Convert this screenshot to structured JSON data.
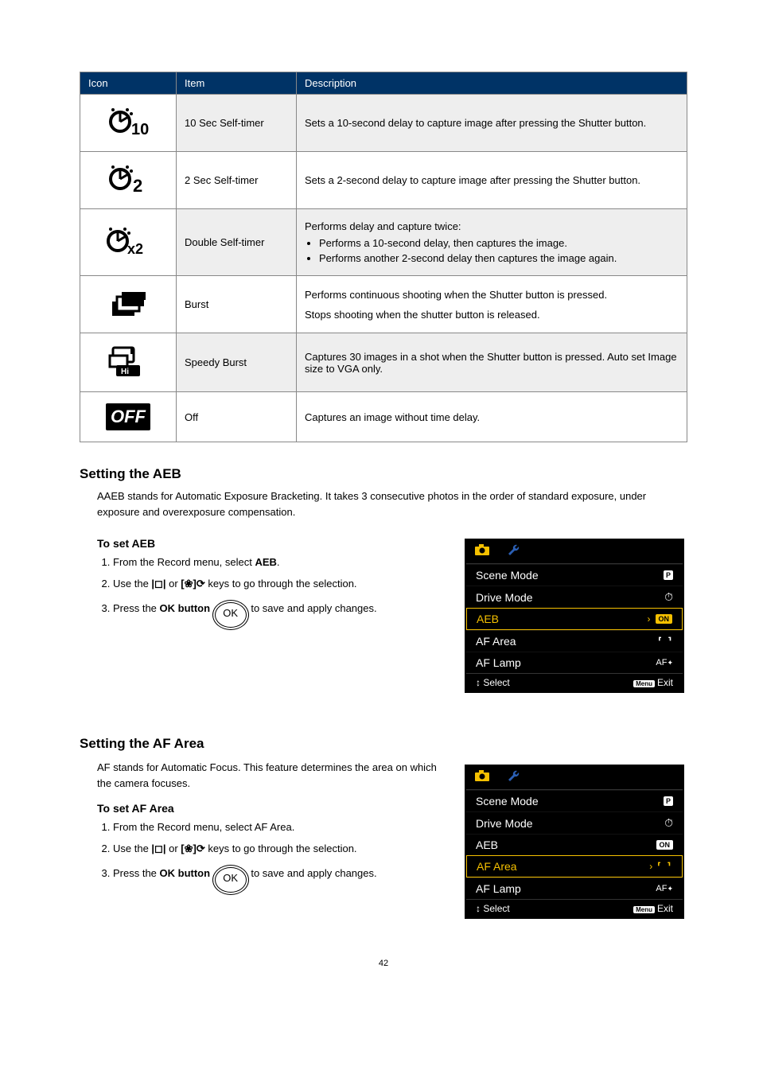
{
  "table": {
    "headers": {
      "icon": "Icon",
      "item": "Item",
      "desc": "Description"
    },
    "rows": [
      {
        "item": "10 Sec Self-timer",
        "desc": "Sets a 10-second delay to capture image after pressing the Shutter button."
      },
      {
        "item": "2 Sec Self-timer",
        "desc": "Sets a 2-second delay to capture image after pressing the Shutter button."
      },
      {
        "item": "Double Self-timer",
        "desc_intro": "Performs delay and capture twice:",
        "desc_bullets": [
          "Performs a 10-second delay, then captures the image.",
          "Performs another 2-second delay then captures the image again."
        ]
      },
      {
        "item": "Burst",
        "desc_line1": "Performs continuous shooting when the Shutter button is pressed.",
        "desc_line2": "Stops shooting when the shutter button is released."
      },
      {
        "item": "Speedy Burst",
        "desc": "Captures 30 images in a shot when the Shutter button is pressed. Auto set Image size to VGA only."
      },
      {
        "item": "Off",
        "desc": "Captures an image without time delay."
      }
    ]
  },
  "aeb": {
    "heading": "Setting the AEB",
    "para": "AAEB stands for Automatic Exposure Bracketing. It takes 3 consecutive photos in the order of standard exposure, under exposure and overexposure compensation.",
    "sub": "To set AEB",
    "step1_a": "From the Record menu, select ",
    "step1_b": "AEB",
    "step1_c": ".",
    "step2_a": "Use the ",
    "step2_mid": " or ",
    "step2_b": " keys to go through the selection.",
    "step3_a": "Press the ",
    "step3_b": "OK button",
    "step3_c": " to save and apply changes."
  },
  "afarea": {
    "heading": "Setting the AF Area",
    "para": "AF stands for Automatic Focus. This feature determines the area on which the camera focuses.",
    "sub": "To set AF Area",
    "step1": "From the Record menu, select AF Area.",
    "step2_a": "Use the ",
    "step2_mid": " or ",
    "step2_b": " keys to go through the selection.",
    "step3_a": "Press the ",
    "step3_b": "OK button",
    "step3_c": " to save and apply changes."
  },
  "menu_aeb": {
    "items": [
      {
        "label": "Scene Mode",
        "value_type": "p"
      },
      {
        "label": "Drive Mode",
        "value_type": "timer"
      },
      {
        "label": "AEB",
        "value_type": "on",
        "selected": true
      },
      {
        "label": "AF Area",
        "value_type": "bracket"
      },
      {
        "label": "AF Lamp",
        "value_type": "afk"
      }
    ],
    "footer_select": "Select",
    "footer_exit": "Exit",
    "footer_menu": "Menu"
  },
  "menu_afarea": {
    "items": [
      {
        "label": "Scene Mode",
        "value_type": "p"
      },
      {
        "label": "Drive Mode",
        "value_type": "timer"
      },
      {
        "label": "AEB",
        "value_type": "on"
      },
      {
        "label": "AF Area",
        "value_type": "bracket",
        "selected": true
      },
      {
        "label": "AF Lamp",
        "value_type": "afk"
      }
    ],
    "footer_select": "Select",
    "footer_exit": "Exit",
    "footer_menu": "Menu"
  },
  "ok_label": "OK",
  "off_word": "OFF",
  "on_word": "ON",
  "afk_word": "AF",
  "p_word": "P",
  "page_number": "42",
  "chart_data": {
    "type": "table",
    "title": "Drive Mode icon reference",
    "columns": [
      "Icon",
      "Item",
      "Description"
    ],
    "rows": [
      [
        "10-sec-self-timer-icon",
        "10 Sec Self-timer",
        "Sets a 10-second delay to capture image after pressing the Shutter button."
      ],
      [
        "2-sec-self-timer-icon",
        "2 Sec Self-timer",
        "Sets a 2-second delay to capture image after pressing the Shutter button."
      ],
      [
        "double-self-timer-icon",
        "Double Self-timer",
        "Performs delay and capture twice: Performs a 10-second delay, then captures the image. Performs another 2-second delay then captures the image again."
      ],
      [
        "burst-icon",
        "Burst",
        "Performs continuous shooting when the Shutter button is pressed. Stops shooting when the shutter button is released."
      ],
      [
        "speedy-burst-icon",
        "Speedy Burst",
        "Captures 30 images in a shot when the Shutter button is pressed. Auto set Image size to VGA only."
      ],
      [
        "off-icon",
        "Off",
        "Captures an image without time delay."
      ]
    ]
  }
}
